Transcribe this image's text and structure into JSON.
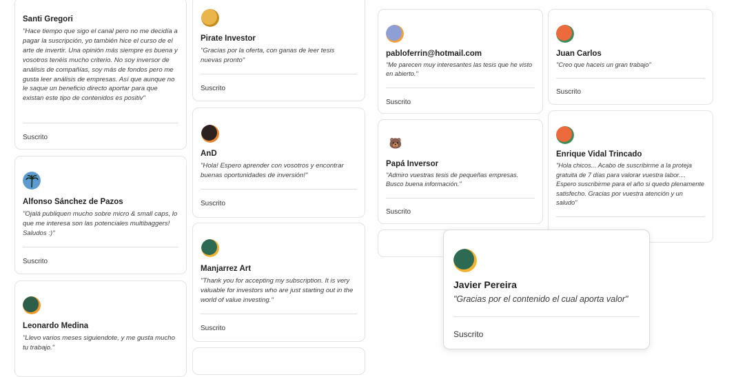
{
  "status_label": "Suscrito",
  "cards": [
    {
      "id": "santi",
      "name": "Santi Gregori",
      "quote": "\"Hace tiempo que sigo el canal pero no me decidía a pagar la suscripción, yo también hice el curso de el arte de invertir. Una opinión más siempre es buena y vosotros tenéis mucho criterio. No soy inversor de análisis de compañías, soy más de fondos pero me gusta leer análisis de empresas. Así que aunque no le saque un beneficio directo aportar para que existan este tipo de contenidos es positiv\""
    },
    {
      "id": "alfonso",
      "name": "Alfonso Sánchez de Pazos",
      "quote": "\"Ojalá publiquen mucho sobre micro & small caps, lo que me interesa son las potenciales multibaggers! Saludos :)\""
    },
    {
      "id": "leonardo",
      "name": "Leonardo Medina",
      "quote": "\"Llevo varios meses siguiendote, y me gusta mucho tu trabajo.\""
    },
    {
      "id": "pirate",
      "name": "Pirate Investor",
      "quote": "\"Gracias por la oferta, con ganas de leer tesis nuevas pronto\""
    },
    {
      "id": "and",
      "name": "AnD",
      "quote": "\"Hola! Espero aprender con vosotros y encontrar buenas oportunidades de inversión!\""
    },
    {
      "id": "manjarrez",
      "name": "Manjarrez Art",
      "quote": "\"Thank you for accepting my subscription. It is very valuable for investors who are just starting out in the world of value investing.\""
    },
    {
      "id": "pablo",
      "name": "pabloferrin@hotmail.com",
      "quote": "\"Me parecen muy interesantes las tesis que he visto en abierto.\""
    },
    {
      "id": "papa",
      "name": "Papá Inversor",
      "quote": "\"Admiro vuestras tesis de pequeñas empresas. Busco buena información.\""
    },
    {
      "id": "juan",
      "name": "Juan Carlos",
      "quote": "\"Creo que haceis un gran trabajo\""
    },
    {
      "id": "enrique",
      "name": "Enrique Vidal Trincado",
      "quote": "\"Hola chicos... Acabo de suscribirme a la proteja gratuita de 7 días para valorar vuestra labor.... Espero suscribirme para el año si quedo plenamente satisfecho. Gracias por vuestra atención y un saludo\""
    },
    {
      "id": "javier",
      "name": "Javier Pereira",
      "quote": "\"Gracias por el contenido el cual aporta valor\""
    }
  ],
  "avatars": {
    "pirate": {
      "icon": "coin-avatar-icon",
      "back": "#c58d1e",
      "front": "#eab54a"
    },
    "and": {
      "icon": "avatar-icon",
      "back": "#e6862c",
      "front": "#2b2220"
    },
    "manjarrez": {
      "icon": "avatar-icon",
      "back": "#f4b233",
      "front": "#2d6a53"
    },
    "leonardo": {
      "icon": "avatar-icon",
      "back": "#f29a2e",
      "front": "#2c5e4a"
    },
    "alfonso": {
      "icon": "palm-tree-avatar-icon",
      "back": "#6fa8d6",
      "front": "#5b9bd0"
    },
    "pablo": {
      "icon": "avatar-icon",
      "back": "#f0a13a",
      "front": "#8e9fd8"
    },
    "papa": {
      "icon": "emoji-avatar-icon",
      "glyph": "🐻"
    },
    "juan": {
      "icon": "avatar-icon",
      "back": "#3c8c5a",
      "front": "#ec6a3b"
    },
    "enrique": {
      "icon": "avatar-icon",
      "back": "#3c8c5a",
      "front": "#ec6a3b"
    },
    "javier": {
      "icon": "avatar-icon",
      "back": "#f4b233",
      "front": "#2d6a53"
    }
  }
}
